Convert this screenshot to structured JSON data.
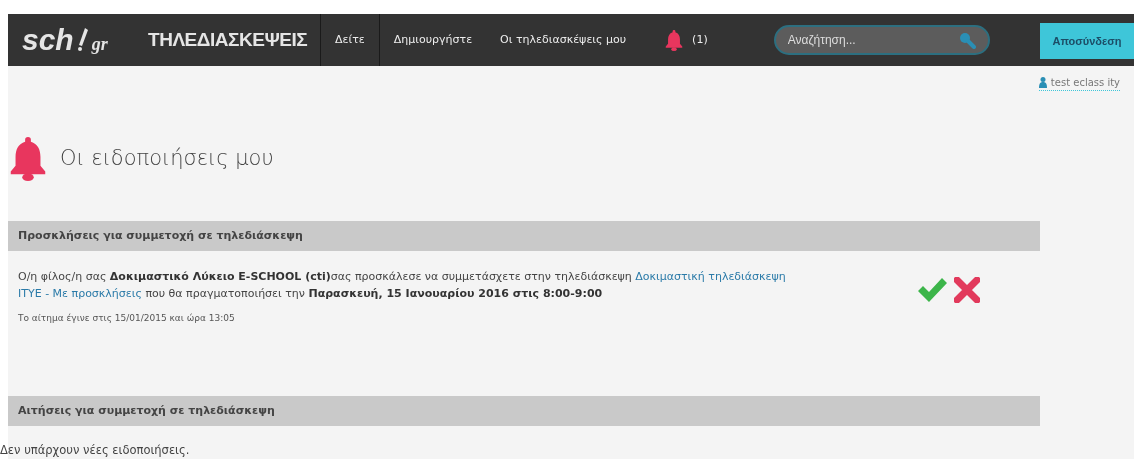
{
  "logo": {
    "left": "sch",
    "right": "gr",
    "title": "ΤΗΛΕΔΙΑΣΚΕΨΕΙΣ"
  },
  "nav": [
    {
      "label": "Δείτε"
    },
    {
      "label": "Δημιουργήστε"
    },
    {
      "label": "Οι τηλεδιασκέψεις μου"
    }
  ],
  "notifications": {
    "count": "(1)"
  },
  "search": {
    "placeholder": "Αναζήτηση..."
  },
  "logout": "Αποσύνδεση",
  "user": "test eclass ity",
  "page_title": "Οι ειδοποιήσεις μου",
  "sections": [
    {
      "title": "Προσκλήσεις για συμμετοχή σε τηλεδιάσκεψη",
      "items": [
        {
          "segments": [
            {
              "kind": "text",
              "text": "Ο/η φίλος/η σας "
            },
            {
              "kind": "bold",
              "text": "Δοκιμαστικό Λύκειο E-SCHOOL (cti)"
            },
            {
              "kind": "text",
              "text": "σας προσκάλεσε να συμμετάσχετε στην τηλεδιάσκεψη "
            },
            {
              "kind": "link",
              "text": "Δοκιμαστική τηλεδιάσκεψη"
            },
            {
              "kind": "link",
              "text": "ΙΤΥΕ - Με προσκλήσεις"
            },
            {
              "kind": "text",
              "text": " που θα πραγματοποιήσει την "
            },
            {
              "kind": "bold",
              "text": "Παρασκευή, 15 Ιανουαρίου 2016 στις 8:00-9:00"
            }
          ],
          "meta": "Το αίτημα έγινε στις 15/01/2015 και ώρα 13:05"
        }
      ]
    },
    {
      "title": "Αιτήσεις για συμμετοχή σε τηλεδιάσκεψη",
      "empty": "Δεν υπάρχουν νέες ειδοποιήσεις."
    }
  ]
}
